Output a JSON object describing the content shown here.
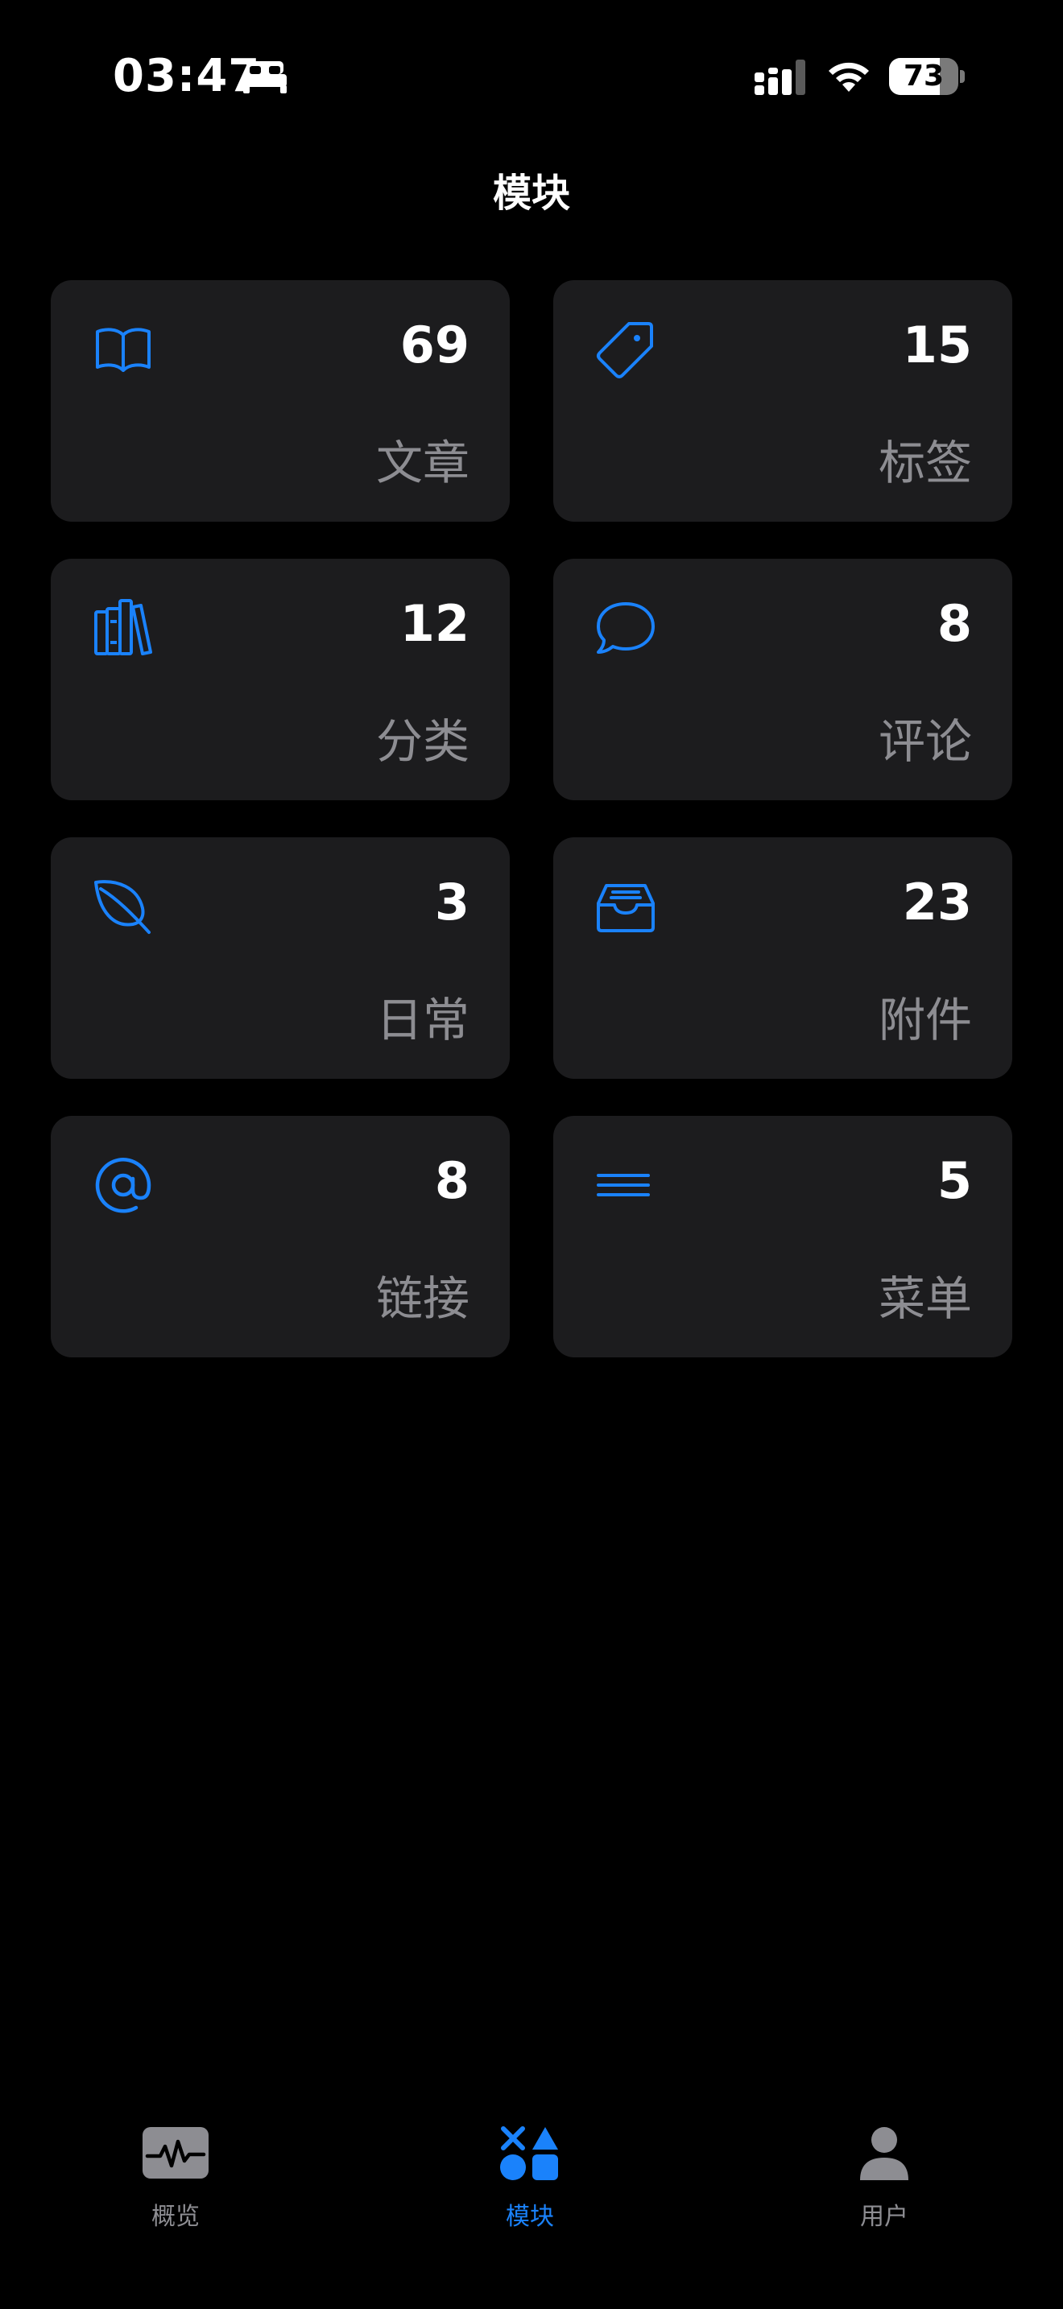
{
  "status_bar": {
    "time": "03:47",
    "battery_level": "73",
    "battery_fraction": 0.73,
    "icons": [
      "bed-icon",
      "cellular-signal-icon",
      "wifi-icon",
      "battery-icon"
    ]
  },
  "header": {
    "title": "模块"
  },
  "modules": [
    {
      "count": "69",
      "label": "文章",
      "icon": "book-icon"
    },
    {
      "count": "15",
      "label": "标签",
      "icon": "tag-icon"
    },
    {
      "count": "12",
      "label": "分类",
      "icon": "books-icon"
    },
    {
      "count": "8",
      "label": "评论",
      "icon": "speech-bubble-icon"
    },
    {
      "count": "3",
      "label": "日常",
      "icon": "leaf-icon"
    },
    {
      "count": "23",
      "label": "附件",
      "icon": "tray-icon"
    },
    {
      "count": "8",
      "label": "链接",
      "icon": "at-sign-icon"
    },
    {
      "count": "5",
      "label": "菜单",
      "icon": "menu-lines-icon"
    }
  ],
  "tab_bar": {
    "tabs": [
      {
        "label": "概览",
        "icon": "waveform-icon",
        "active": false
      },
      {
        "label": "模块",
        "icon": "shapes-icon",
        "active": true
      },
      {
        "label": "用户",
        "icon": "person-icon",
        "active": false
      }
    ]
  },
  "colors": {
    "accent": "#1a82fb",
    "background": "#000000",
    "card": "#1c1c1e",
    "secondary_text": "#8d8d92"
  }
}
